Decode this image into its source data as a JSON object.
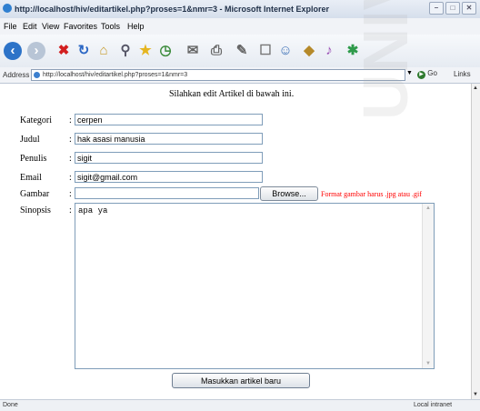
{
  "window": {
    "title": "http://localhost/hiv/editartikel.php?proses=1&nmr=3 - Microsoft Internet Explorer"
  },
  "menu": [
    "File",
    "Edit",
    "View",
    "Favorites",
    "Tools",
    "Help"
  ],
  "address": {
    "label": "Address",
    "url": "http://localhost/hiv/editartikel.php?proses=1&nmr=3",
    "go": "Go",
    "links": "Links"
  },
  "page": {
    "heading": "Silahkan edit Artikel di bawah ini.",
    "fields": [
      {
        "label": "Kategori",
        "value": "cerpen"
      },
      {
        "label": "Judul",
        "value": "hak asasi manusia"
      },
      {
        "label": "Penulis",
        "value": "sigit"
      },
      {
        "label": "Email",
        "value": "sigit@gmail.com"
      }
    ],
    "gambar_label": "Gambar",
    "browse_label": "Browse...",
    "format_note": "Format gambar harus .jpg atau .gif",
    "sinopsis_label": "Sinopsis",
    "sinopsis_value": "apa ya",
    "submit_label": "Masukkan artikel baru"
  },
  "status": {
    "left": "Done",
    "right": "Local intranet"
  },
  "watermark": "UNIVERSITAS"
}
